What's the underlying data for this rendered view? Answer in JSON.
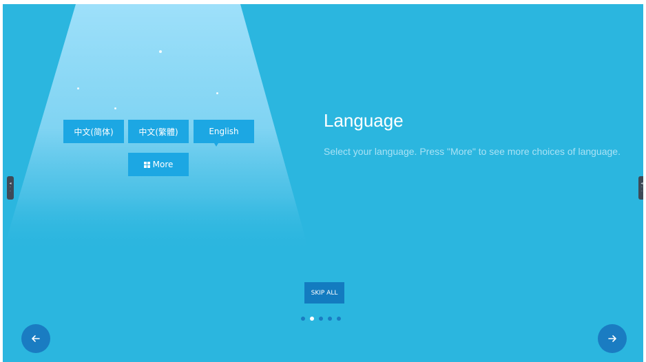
{
  "language_page": {
    "title": "Language",
    "description": "Select your language. Press \"More\" to see more choices of language."
  },
  "language_options": [
    {
      "label": "中文(简体)"
    },
    {
      "label": "中文(繁體)"
    },
    {
      "label": "English"
    }
  ],
  "more_button": {
    "label": "More",
    "icon": "grid-icon"
  },
  "skip_button": {
    "label": "SKIP ALL"
  },
  "pagination": {
    "total": 5,
    "current": 2
  },
  "navigation": {
    "prev_icon": "arrow-left-icon",
    "next_icon": "arrow-right-icon"
  },
  "side_tabs": {
    "icon": "side-panel-handle-icon"
  },
  "colors": {
    "background": "#2bb6df",
    "spotlight": "#a8e4fb",
    "button": "#1ca7e3",
    "skip_button": "#137bc0",
    "nav_button": "#1a7cc2",
    "subtitle": "#a9e2f5"
  }
}
